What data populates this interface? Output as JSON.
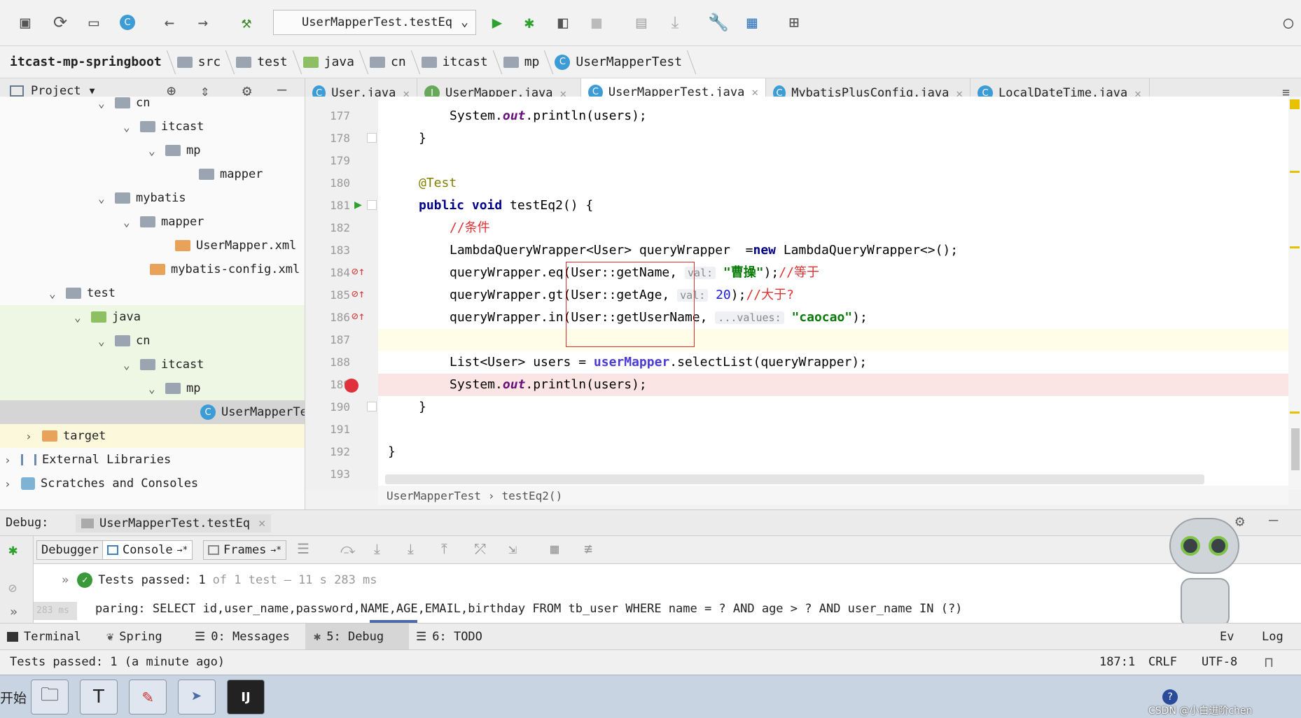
{
  "toolbar": {
    "run_config": "UserMapperTest.testEq"
  },
  "breadcrumb": [
    "itcast-mp-springboot",
    "src",
    "test",
    "java",
    "cn",
    "itcast",
    "mp",
    "UserMapperTest"
  ],
  "project_panel": {
    "title": "Project"
  },
  "tree": [
    {
      "label": "cn"
    },
    {
      "label": "itcast"
    },
    {
      "label": "mp"
    },
    {
      "label": "mapper"
    },
    {
      "label": "mybatis"
    },
    {
      "label": "mapper"
    },
    {
      "label": "UserMapper.xml"
    },
    {
      "label": "mybatis-config.xml"
    },
    {
      "label": "test"
    },
    {
      "label": "java"
    },
    {
      "label": "cn"
    },
    {
      "label": "itcast"
    },
    {
      "label": "mp"
    },
    {
      "label": "UserMapperTe"
    },
    {
      "label": "target"
    },
    {
      "label": "External Libraries"
    },
    {
      "label": "Scratches and Consoles"
    }
  ],
  "tabs": [
    {
      "label": "User.java",
      "icon": "C"
    },
    {
      "label": "UserMapper.java",
      "icon": "I"
    },
    {
      "label": "UserMapperTest.java",
      "icon": "C"
    },
    {
      "label": "MybatisPlusConfig.java",
      "icon": "C"
    },
    {
      "label": "LocalDateTime.java",
      "icon": "C"
    }
  ],
  "line_numbers": [
    "177",
    "178",
    "179",
    "180",
    "181",
    "182",
    "183",
    "184",
    "185",
    "186",
    "187",
    "188",
    "189",
    "190",
    "191",
    "192",
    "193"
  ],
  "code": {
    "l177_a": "System.",
    "l177_b": "out",
    "l177_c": ".println(users);",
    "l178": "}",
    "l180": "@Test",
    "l181_kw": "public void",
    "l181_rest": " testEq2() {",
    "l182": "//条件",
    "l183_a": "LambdaQueryWrapper<User> queryWrapper  =",
    "l183_kw": "new",
    "l183_b": " LambdaQueryWrapper<>();",
    "l184_a": "queryWrapper.eq(User::getName, ",
    "l184_hint": "val:",
    "l184_str": " \"曹操\"",
    "l184_b": ");",
    "l184_cm": "//等于",
    "l185_a": "queryWrapper.gt(User::getAge, ",
    "l185_hint": "val:",
    "l185_num": " 20",
    "l185_b": ");",
    "l185_cm": "//大于?",
    "l186_a": "queryWrapper.in(User::getUserName, ",
    "l186_hint": "...values:",
    "l186_str": " \"caocao\"",
    "l186_b": ");",
    "l188_a": "List<User> users = ",
    "l188_mem": "userMapper",
    "l188_b": ".selectList(queryWrapper);",
    "l189_a": "System.",
    "l189_b": "out",
    "l189_c": ".println(users);",
    "l190": "}",
    "l192": "}"
  },
  "nav_breadcrumb": {
    "class": "UserMapperTest",
    "sep": "›",
    "method": "testEq2()"
  },
  "debug": {
    "label": "Debug:",
    "session": "UserMapperTest.testEq",
    "tabs": [
      "Debugger",
      "Console",
      "Frames"
    ],
    "result_prefix": "Tests passed:",
    "result_count": "1",
    "result_of": "of 1 test",
    "result_dash": "–",
    "result_time": "11 s 283 ms",
    "log_time": "283 ms",
    "log_line": "paring: SELECT id,user_name,password,NAME,AGE,EMAIL,birthday FROM tb_user WHERE name = ? AND age > ? AND user_name IN (?)"
  },
  "bottom_tabs": [
    "Terminal",
    "Spring",
    "0: Messages",
    "5: Debug",
    "6: TODO",
    "Ev",
    "Log"
  ],
  "status": {
    "message": "Tests passed: 1 (a minute ago)",
    "position": "187:1",
    "line_sep": "CRLF",
    "encoding": "UTF-8"
  },
  "taskbar": {
    "start": "开始",
    "watermark": "CSDN @小白进阶chen"
  },
  "colors": {
    "accent": "#4a88c7",
    "string": "#077a07",
    "comment": "#e03030",
    "keyword": "#00008b",
    "breakpoint": "#e0303b"
  }
}
